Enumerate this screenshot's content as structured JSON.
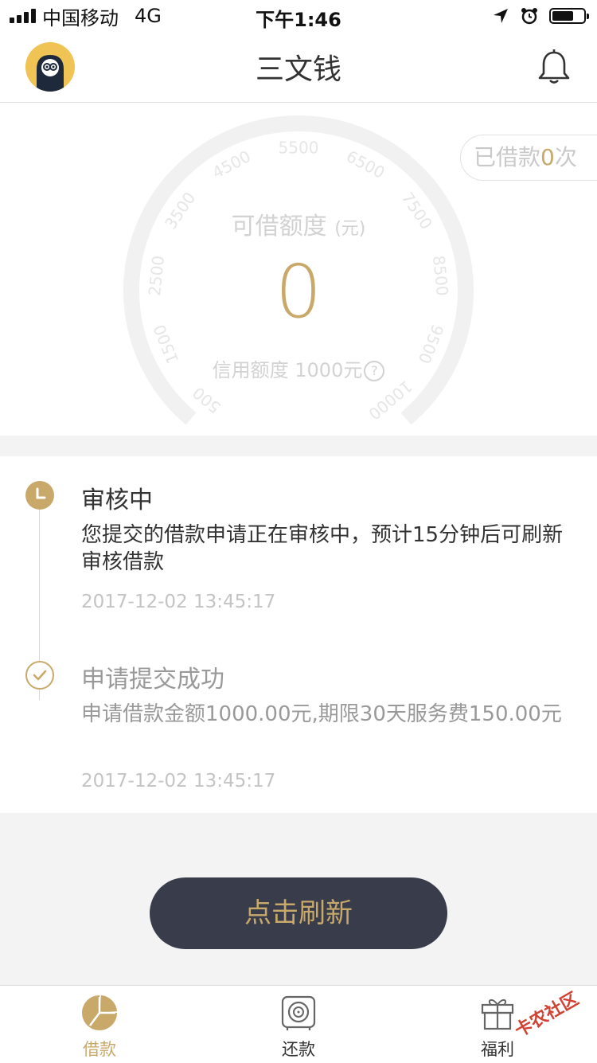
{
  "status_bar": {
    "carrier": "中国移动",
    "network": "4G",
    "time": "下午1:46"
  },
  "header": {
    "title": "三文钱"
  },
  "gauge": {
    "label": "可借额度",
    "unit": "(元)",
    "amount": "0",
    "credit_line": "信用额度 1000元",
    "scale_min": 500,
    "scale_max": 10000,
    "ticks": [
      "500",
      "1500",
      "2500",
      "3500",
      "4500",
      "5500",
      "6500",
      "7500",
      "8500",
      "9500",
      "10000"
    ],
    "borrowed_prefix": "已借款",
    "borrowed_count": "0",
    "borrowed_suffix": "次"
  },
  "timeline": {
    "items": [
      {
        "title": "审核中",
        "body": "您提交的借款申请正在审核中，预计15分钟后可刷新审核借款",
        "time": "2017-12-02 13:45:17",
        "title_color": "#333333",
        "body_color": "#333333"
      },
      {
        "title": "申请提交成功",
        "body": "申请借款金额1000.00元,期限30天服务费150.00元",
        "time": "2017-12-02 13:45:17",
        "title_color": "#999999",
        "body_color": "#999999"
      }
    ]
  },
  "refresh_button": {
    "label": "点击刷新"
  },
  "tabs": [
    {
      "label": "借款",
      "icon": "loan-pie-icon",
      "active": true
    },
    {
      "label": "还款",
      "icon": "repay-safe-icon",
      "active": false
    },
    {
      "label": "福利",
      "icon": "gift-icon",
      "active": false
    }
  ],
  "watermark": {
    "text": "卡农社区"
  },
  "colors": {
    "accent_gold": "#c8a96a",
    "button_dark": "#393c4a",
    "avatar_yellow": "#f0c454"
  }
}
